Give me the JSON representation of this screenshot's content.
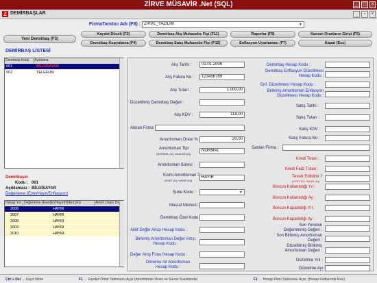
{
  "app": {
    "title": "ZİRVE MÜSAVİR .Net (SQL)",
    "window_title": "DEMİRBAŞLAR",
    "logo": "Z"
  },
  "firma": {
    "label": "FirmaTanıtıcı Adı (F8) :",
    "value": "ZIRVE_YAZILIM"
  },
  "buttons": {
    "yeni": "Yeni Demirbaş (F3)",
    "kaydet": "Kaydet Düzelt (F2)",
    "alis_fisi": "Demirbaş Alış Muhasebe Fişi (F11)",
    "raporlar": "Raporlar (F9)",
    "kanuni": "Kanuni Oranların Girişi (F5)",
    "kopyalama": "Demirbaş Kopyalama (F4)",
    "satis_fisi": "Demirbaş Satış Muhasebe Fişi (F12)",
    "enflasyon": "Enflasyon Uyarlaması (F7)",
    "kapat": "Kapat (Esc)"
  },
  "list": {
    "title": "DEMİRBAŞ LİSTESİ",
    "headers": [
      "Demirbaş Kodu",
      "Açıklama"
    ],
    "rows": [
      {
        "code": "001",
        "desc": "BİLGİSAYAR"
      },
      {
        "code": "002",
        "desc": "TELEFON"
      }
    ]
  },
  "info": {
    "title": "Demirbaşın",
    "kodu_label": "Kodu :",
    "kodu": "001",
    "aciklama_label": "Açıklaması :",
    "aciklama": "BİLGİSAYAR",
    "link": "Değerleme (Evet/Hayır/Enflasyon)"
  },
  "year_table": {
    "headers": [
      "Hesap Yılı",
      "Değerleme (Evet(E)/Hayır(H)/Enf.(F))",
      "Amort.Oranı (%)"
    ],
    "rows": [
      {
        "year": "2006",
        "val": "HAYIR"
      },
      {
        "year": "2007",
        "val": "HAYIR"
      },
      {
        "year": "2008",
        "val": "HAYIR"
      },
      {
        "year": "2009",
        "val": "HAYIR"
      },
      {
        "year": "2010",
        "val": "HAYIR"
      }
    ]
  },
  "form": {
    "alis_tarihi": {
      "label": "Alış Tarihi :",
      "value": "01.01.2006"
    },
    "alis_fatura": {
      "label": "Alış Fatura No :",
      "value": "123456789"
    },
    "alis_tutari": {
      "label": "Alış Tutarı :",
      "value": "1.000,00"
    },
    "duzeltilmis": {
      "label": "Düzeltilmiş Demirbaş Değeri :",
      "value": ""
    },
    "alis_kdv": {
      "label": "Alış KDV :",
      "value": "118,00"
    },
    "alinan_firma": {
      "label": "Alınan Firma :",
      "value": ""
    },
    "amort_orani": {
      "label": "Amortisman Oranı % :",
      "value": "20,00"
    },
    "amort_tipi": {
      "label": "Amortisman Tipi",
      "sub": "(NORMAL (N), AZALAN (A))",
      "value": "NORMAL"
    },
    "amort_suresi": {
      "label": "Amortisman Süresi :",
      "value": ""
    },
    "kismi": {
      "label": "Kısmi Amortisman ? :",
      "sub": "(EVET (E), HAYIR (H))",
      "value": "HAYIR"
    },
    "sube": {
      "label": "Şube Kodu :",
      "value": ""
    },
    "masraf": {
      "label": "Masraf Merkezi :",
      "value": ""
    },
    "ozel_kod": {
      "label": "Demirbaş Özel Kodu :",
      "value": ""
    },
    "aktif_deger": {
      "label": "Aktif Değer Artışı Hesap Kodu :",
      "value": ""
    },
    "birikmis_deger": {
      "label": "Birikmiş Amortisman Değer Artışı Hesap Kodu :",
      "value": ""
    },
    "deger_fonu": {
      "label": "Değer Artış Fonu Hesap Kodu :",
      "value": ""
    },
    "donem_sonu": {
      "label": "Döneme Ait Amortisman Hesap Kodu :",
      "value": ""
    }
  },
  "right_form": {
    "hesap_kodu": "Demirbaş Hesap Kodu :",
    "enf_duz": "Demirbaş Enflasyon Düzeltmesi Hesap Kodu :",
    "enf_duz2": "Enf. Düzeltmesi Hesap Kodu :",
    "birikmis_enf": "Birikmiş Amortisman Enflasyon Düzeltmesi Hesap Kodu :",
    "satis_tarihi": "Satış Tarihi :",
    "satis_tutari": "Satış Tutarı :",
    "satis_kdv": "Satış KDV :",
    "satis_fatura": "Satış Fatura No :",
    "satilan_firma": "Satılan Firma :",
    "kredi_tutari": "Kredi Tutarı :",
    "kredi_faizi": "Kredi Faizi Tutarı :",
    "tevsik": "Tevsik Edildimi ?",
    "tevsik_sub": "(EVET (E), HAYIR (H))",
    "borcun_yil": "Borcun Kullanıldığı Yıl :",
    "borcun_ay": "Borcun Kullanıldığı Ay :",
    "kapat_yil": "Borcun Kapatıldığı Yıl :",
    "kapat_ay": "Borcun Kapatıldığı Ay :",
    "son_yeniden": "Son Yeniden Değerlenmiş Değeri :",
    "son_birikmis": "Son Birikmiş Amortisman Değeri :",
    "duz_birikmis": "Düzeltilmiş Birikmiş Amortisman Değeri :",
    "duz_yili": "Düzeltme Yılı :",
    "duz_ayi": "Düzeltme Ayı :"
  },
  "footer": {
    "ctl_key": "Ctrl + Del",
    "ctl_text": "Kayıt Silme",
    "f1a_key": "F1",
    "f1a_text": "Faydalı Ömür Tablosunu Açar (Amortisman Oranı ve Süresi Sulunlanda)",
    "f1b_key": "F1",
    "f1b_text": "Hesap Planı Tablosunu Açar. (Hesap Kodlarında İken)"
  },
  "colors": {
    "accent": "#8a0f0f",
    "selected_row": "#0a0a80",
    "selected_text": "#ffffff",
    "yellow_row": "#fdf7c8"
  }
}
